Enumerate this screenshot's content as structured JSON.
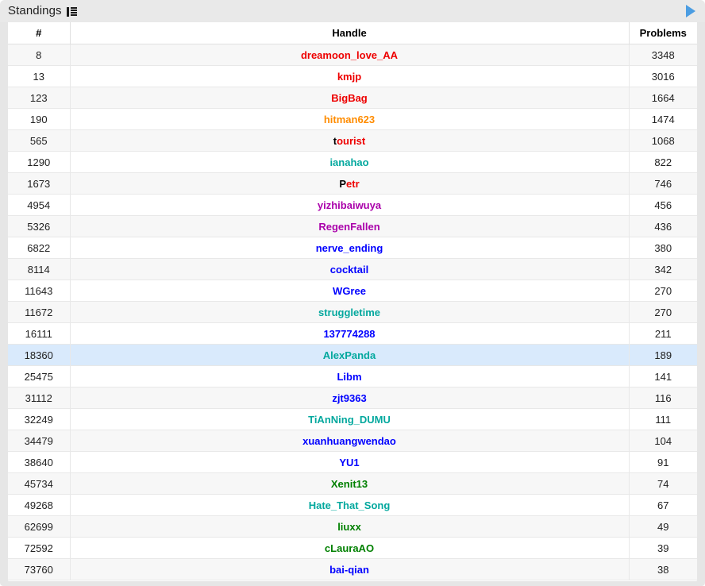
{
  "titlebar": {
    "title": "Standings",
    "list_icon": "list-icon",
    "expand_arrow_icon": "play-triangle-icon",
    "accent_color": "#2f8fe0"
  },
  "table": {
    "columns": [
      {
        "key": "rank",
        "label": "#"
      },
      {
        "key": "handle",
        "label": "Handle"
      },
      {
        "key": "problems",
        "label": "Problems"
      }
    ],
    "highlight_color": "#d9eafc",
    "rows": [
      {
        "rank": "8",
        "handle": "dreamoon_love_AA",
        "handle_color": "#ee0000",
        "style": "red",
        "problems": "3348",
        "highlight": false
      },
      {
        "rank": "13",
        "handle": "kmjp",
        "handle_color": "#ee0000",
        "style": "red",
        "problems": "3016",
        "highlight": false
      },
      {
        "rank": "123",
        "handle": "BigBag",
        "handle_color": "#ee0000",
        "style": "red",
        "problems": "1664",
        "highlight": false
      },
      {
        "rank": "190",
        "handle": "hitman623",
        "handle_color": "#ff8c00",
        "style": "orange",
        "problems": "1474",
        "highlight": false
      },
      {
        "rank": "565",
        "handle": "tourist",
        "handle_color": "#ee0000",
        "style": "legend",
        "problems": "1068",
        "highlight": false
      },
      {
        "rank": "1290",
        "handle": "ianahao",
        "handle_color": "#03a89e",
        "style": "cyan",
        "problems": "822",
        "highlight": false
      },
      {
        "rank": "1673",
        "handle": "Petr",
        "handle_color": "#ee0000",
        "style": "legend",
        "problems": "746",
        "highlight": false
      },
      {
        "rank": "4954",
        "handle": "yizhibaiwuya",
        "handle_color": "#aa00aa",
        "style": "violet",
        "problems": "456",
        "highlight": false
      },
      {
        "rank": "5326",
        "handle": "RegenFallen",
        "handle_color": "#aa00aa",
        "style": "violet",
        "problems": "436",
        "highlight": false
      },
      {
        "rank": "6822",
        "handle": "nerve_ending",
        "handle_color": "#0000ff",
        "style": "blue",
        "problems": "380",
        "highlight": false
      },
      {
        "rank": "8114",
        "handle": "cocktail",
        "handle_color": "#0000ff",
        "style": "blue",
        "problems": "342",
        "highlight": false
      },
      {
        "rank": "11643",
        "handle": "WGree",
        "handle_color": "#0000ff",
        "style": "blue",
        "problems": "270",
        "highlight": false
      },
      {
        "rank": "11672",
        "handle": "struggletime",
        "handle_color": "#03a89e",
        "style": "cyan",
        "problems": "270",
        "highlight": false
      },
      {
        "rank": "16111",
        "handle": "137774288",
        "handle_color": "#0000ff",
        "style": "blue",
        "problems": "211",
        "highlight": false
      },
      {
        "rank": "18360",
        "handle": "AlexPanda",
        "handle_color": "#03a89e",
        "style": "cyan",
        "problems": "189",
        "highlight": true
      },
      {
        "rank": "25475",
        "handle": "Libm",
        "handle_color": "#0000ff",
        "style": "blue",
        "problems": "141",
        "highlight": false
      },
      {
        "rank": "31112",
        "handle": "zjt9363",
        "handle_color": "#0000ff",
        "style": "blue",
        "problems": "116",
        "highlight": false
      },
      {
        "rank": "32249",
        "handle": "TiAnNing_DUMU",
        "handle_color": "#03a89e",
        "style": "cyan",
        "problems": "111",
        "highlight": false
      },
      {
        "rank": "34479",
        "handle": "xuanhuangwendao",
        "handle_color": "#0000ff",
        "style": "blue",
        "problems": "104",
        "highlight": false
      },
      {
        "rank": "38640",
        "handle": "YU1",
        "handle_color": "#0000ff",
        "style": "blue",
        "problems": "91",
        "highlight": false
      },
      {
        "rank": "45734",
        "handle": "Xenit13",
        "handle_color": "#008000",
        "style": "green",
        "problems": "74",
        "highlight": false
      },
      {
        "rank": "49268",
        "handle": "Hate_That_Song",
        "handle_color": "#03a89e",
        "style": "cyan",
        "problems": "67",
        "highlight": false
      },
      {
        "rank": "62699",
        "handle": "liuxx",
        "handle_color": "#008000",
        "style": "green",
        "problems": "49",
        "highlight": false
      },
      {
        "rank": "72592",
        "handle": "cLauraAO",
        "handle_color": "#008000",
        "style": "green",
        "problems": "39",
        "highlight": false
      },
      {
        "rank": "73760",
        "handle": "bai-qian",
        "handle_color": "#0000ff",
        "style": "blue",
        "problems": "38",
        "highlight": false
      }
    ]
  }
}
